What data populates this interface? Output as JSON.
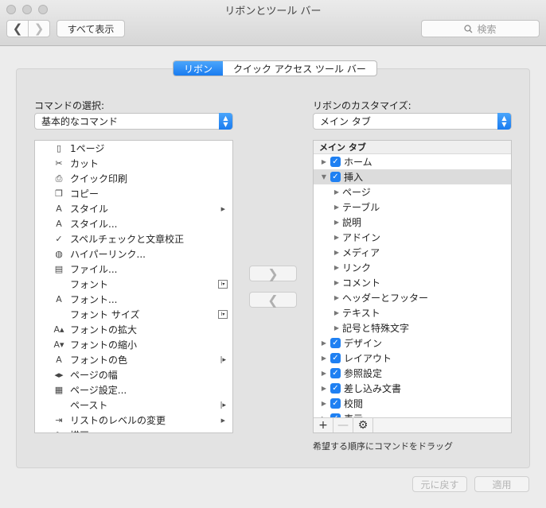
{
  "window": {
    "title": "リボンとツール バー"
  },
  "toolbar": {
    "show_all": "すべて表示",
    "search_placeholder": "検索",
    "back_glyph": "❮",
    "forward_glyph": "❯"
  },
  "tabs": [
    {
      "label": "リボン",
      "active": true
    },
    {
      "label": "クイック アクセス ツール バー",
      "active": false
    }
  ],
  "left": {
    "label": "コマンドの選択:",
    "selected": "基本的なコマンド",
    "commands": [
      {
        "label": "1ページ",
        "icon": "page-icon",
        "glyph": "▯"
      },
      {
        "label": "カット",
        "icon": "scissors-icon",
        "glyph": "✂"
      },
      {
        "label": "クイック印刷",
        "icon": "quick-print-icon",
        "glyph": "⎙"
      },
      {
        "label": "コピー",
        "icon": "copy-icon",
        "glyph": "❐"
      },
      {
        "label": "スタイル",
        "icon": "style-icon",
        "glyph": "A",
        "submenu": "▶"
      },
      {
        "label": "スタイル...",
        "icon": "style-icon",
        "glyph": "A"
      },
      {
        "label": "スペルチェックと文章校正",
        "icon": "spellcheck-icon",
        "glyph": "✓"
      },
      {
        "label": "ハイパーリンク...",
        "icon": "hyperlink-icon",
        "glyph": "◍"
      },
      {
        "label": "ファイル...",
        "icon": "file-icon",
        "glyph": "▤"
      },
      {
        "label": "フォント",
        "icon": "",
        "glyph": "",
        "box": "I▾"
      },
      {
        "label": "フォント...",
        "icon": "font-icon",
        "glyph": "A"
      },
      {
        "label": "フォント サイズ",
        "icon": "",
        "glyph": "",
        "box": "I▾"
      },
      {
        "label": "フォントの拡大",
        "icon": "font-grow-icon",
        "glyph": "A▴"
      },
      {
        "label": "フォントの縮小",
        "icon": "font-shrink-icon",
        "glyph": "A▾"
      },
      {
        "label": "フォントの色",
        "icon": "font-color-icon",
        "glyph": "A",
        "bar": "|▸"
      },
      {
        "label": "ページの幅",
        "icon": "page-width-icon",
        "glyph": "◂▸"
      },
      {
        "label": "ページ設定...",
        "icon": "page-setup-icon",
        "glyph": "▦"
      },
      {
        "label": "ペースト",
        "icon": "",
        "glyph": "",
        "bar": "|▸"
      },
      {
        "label": "リストのレベルの変更",
        "icon": "list-level-icon",
        "glyph": "⇥",
        "submenu": "▶"
      },
      {
        "label": "描画",
        "icon": "draw-icon",
        "glyph": "✎"
      }
    ]
  },
  "transfer": {
    "add_glyph": "❯",
    "remove_glyph": "❮"
  },
  "right": {
    "label": "リボンのカスタマイズ:",
    "selected": "メイン タブ",
    "header": "メイン タブ",
    "items": [
      {
        "label": "ホーム",
        "level": 0,
        "checked": true,
        "expanded": false
      },
      {
        "label": "挿入",
        "level": 0,
        "checked": true,
        "expanded": true,
        "selected": true
      },
      {
        "label": "ページ",
        "level": 1
      },
      {
        "label": "テーブル",
        "level": 1
      },
      {
        "label": "説明",
        "level": 1
      },
      {
        "label": "アドイン",
        "level": 1
      },
      {
        "label": "メディア",
        "level": 1
      },
      {
        "label": "リンク",
        "level": 1
      },
      {
        "label": "コメント",
        "level": 1
      },
      {
        "label": "ヘッダーとフッター",
        "level": 1
      },
      {
        "label": "テキスト",
        "level": 1
      },
      {
        "label": "記号と特殊文字",
        "level": 1
      },
      {
        "label": "デザイン",
        "level": 0,
        "checked": true,
        "expanded": false
      },
      {
        "label": "レイアウト",
        "level": 0,
        "checked": true,
        "expanded": false
      },
      {
        "label": "参照設定",
        "level": 0,
        "checked": true,
        "expanded": false
      },
      {
        "label": "差し込み文書",
        "level": 0,
        "checked": true,
        "expanded": false
      },
      {
        "label": "校閲",
        "level": 0,
        "checked": true,
        "expanded": false
      },
      {
        "label": "表示",
        "level": 0,
        "checked": true,
        "expanded": false
      }
    ],
    "footer": {
      "add_glyph": "+",
      "remove_glyph": "—",
      "gear_glyph": "⚙"
    },
    "hint": "希望する順序にコマンドをドラッグ"
  },
  "buttons": {
    "revert": "元に戻す",
    "apply": "適用"
  },
  "colors": {
    "accent": "#1f80f2",
    "checkbox": "#1f80f2"
  }
}
